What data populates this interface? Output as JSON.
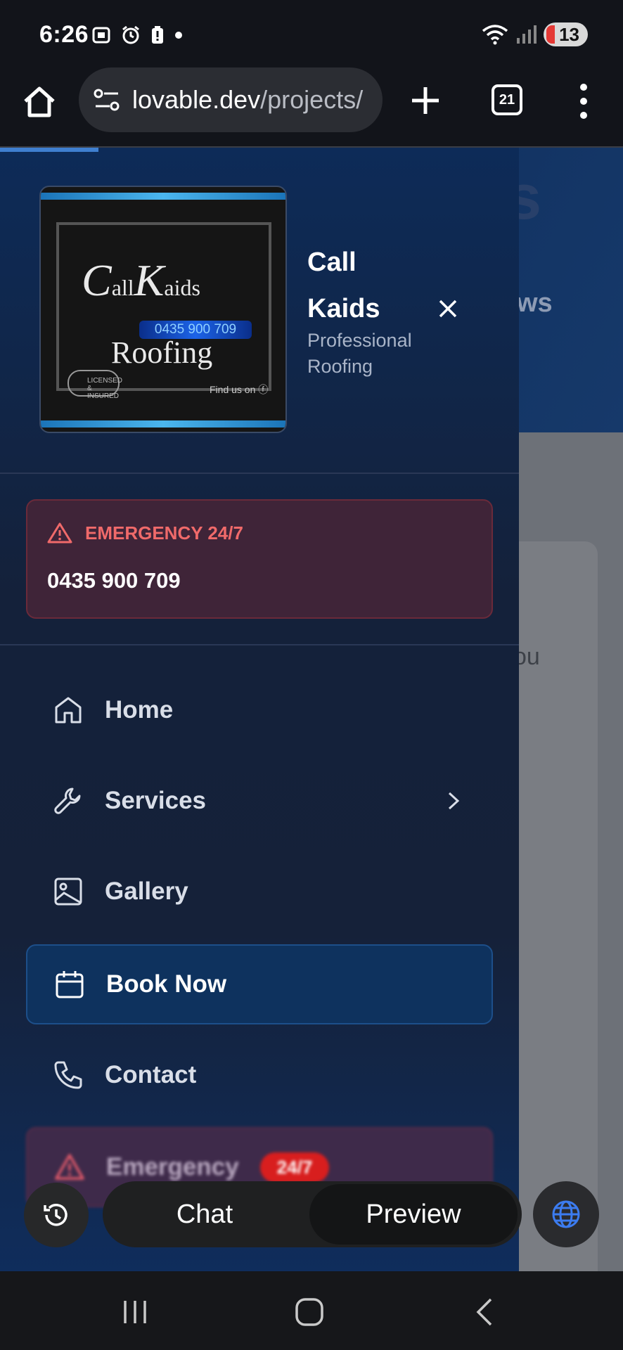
{
  "status_bar": {
    "time": "6:26",
    "battery_level": "13"
  },
  "browser": {
    "url_host": "lovable.dev",
    "url_path": "/projects/",
    "tab_count": "21"
  },
  "background_page": {
    "hero_glyph": "s",
    "hero_partial": "ws",
    "card_partial": "ou"
  },
  "drawer": {
    "logo": {
      "line1_big_c": "C",
      "line1_small1": "all",
      "line1_big_k": "K",
      "line1_small2": "aids",
      "phone": "0435 900 709",
      "line2": "Roofing",
      "badge": "LICENSED & INSURED",
      "find_us": "Find us on"
    },
    "brand_title_line1": "Call",
    "brand_title_line2": "Kaids",
    "brand_sub_line1": "Professional",
    "brand_sub_line2": "Roofing",
    "emergency": {
      "label": "EMERGENCY 24/7",
      "phone": "0435 900 709"
    },
    "nav": [
      {
        "label": "Home",
        "icon": "home-icon"
      },
      {
        "label": "Services",
        "icon": "wrench-icon"
      },
      {
        "label": "Gallery",
        "icon": "image-icon"
      },
      {
        "label": "Book Now",
        "icon": "calendar-icon"
      },
      {
        "label": "Contact",
        "icon": "phone-icon"
      }
    ],
    "nav_emergency": {
      "label": "Emergency",
      "badge": "24/7"
    }
  },
  "bottom_controls": {
    "chat_label": "Chat",
    "preview_label": "Preview"
  },
  "colors": {
    "accent_blue": "#0e325e",
    "emergency_red": "#f06a6a",
    "badge_red": "#d81e1e"
  }
}
